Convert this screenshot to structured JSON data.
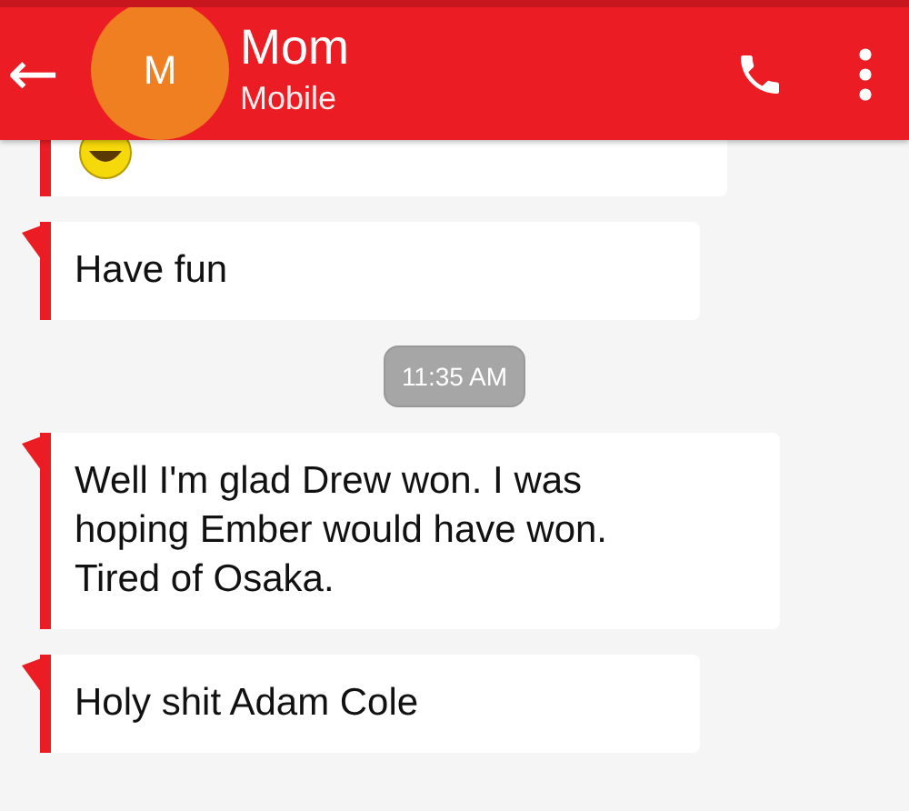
{
  "header": {
    "title": "Mom",
    "subtitle": "Mobile",
    "avatar": "M",
    "back": "←"
  },
  "thread": [
    {
      "kind": "emoji"
    },
    {
      "kind": "message",
      "text": "Have fun"
    },
    {
      "kind": "time",
      "text": "11:35 AM"
    },
    {
      "kind": "message",
      "text": "Well I'm glad Drew won. I was hoping Ember would have won. Tired of Osaka."
    },
    {
      "kind": "message",
      "text": "Holy shit Adam Cole"
    }
  ]
}
